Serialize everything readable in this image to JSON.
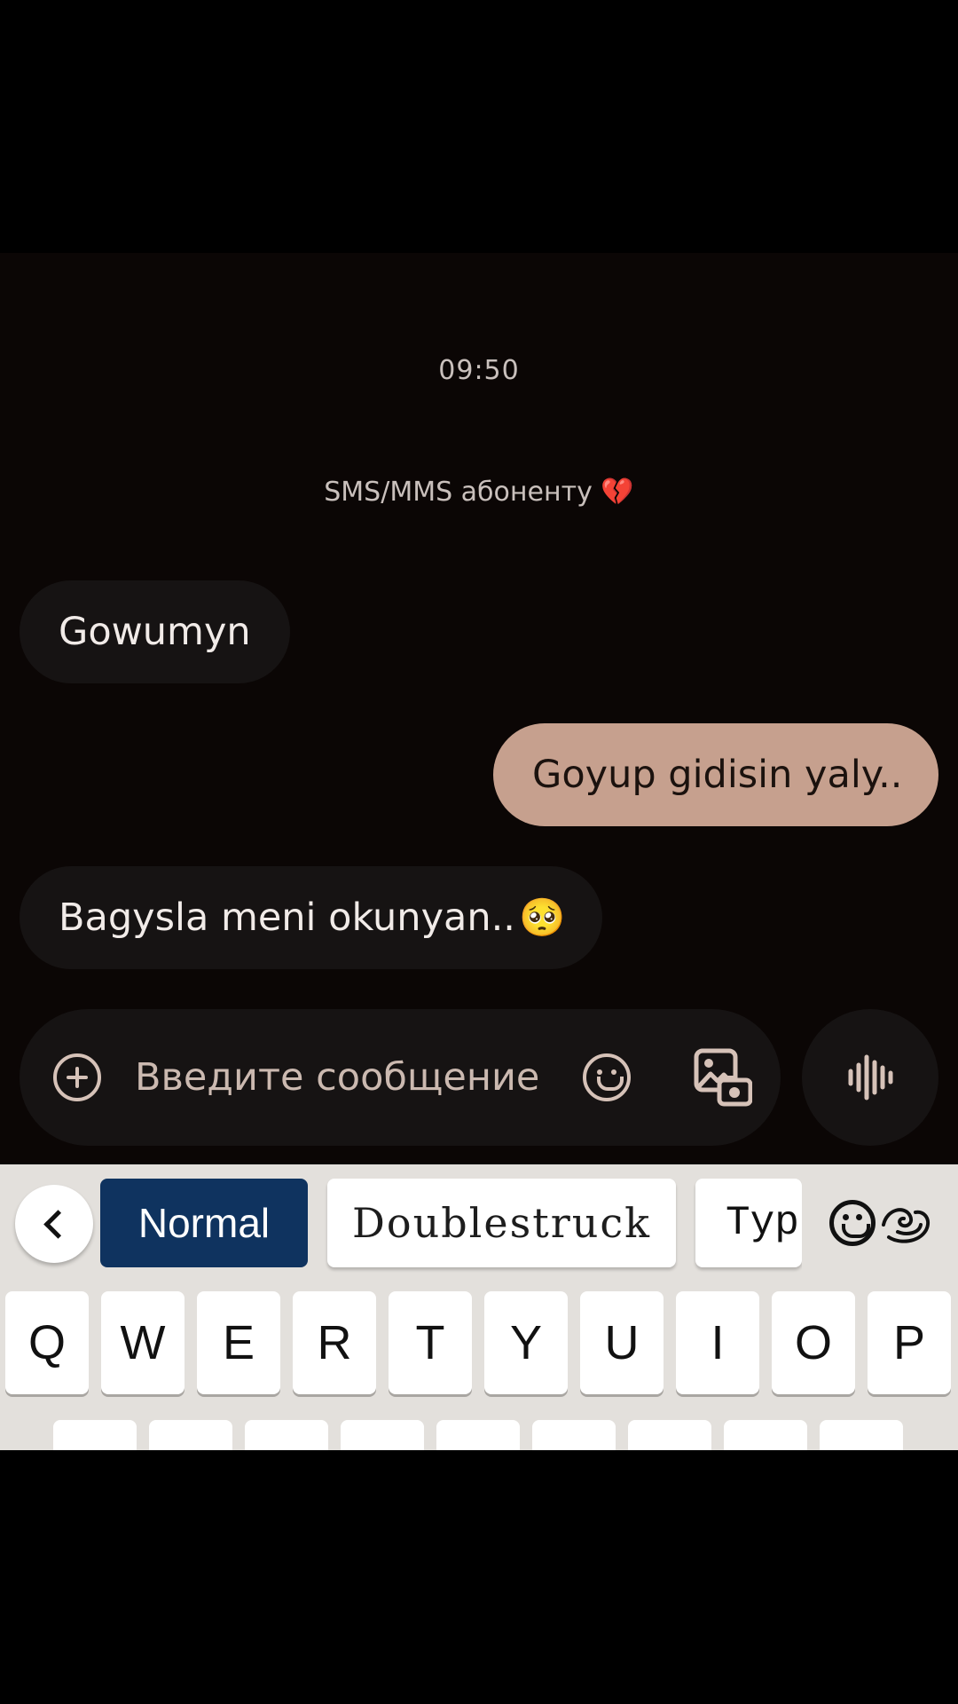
{
  "chat": {
    "timestamp": "09:50",
    "sms_note": "SMS/MMS абоненту",
    "sms_note_emoji": "💔",
    "messages": [
      {
        "direction": "incoming",
        "text": "Gowumyn",
        "emoji": ""
      },
      {
        "direction": "outgoing",
        "text": "Goyup gidisin yaly..",
        "emoji": ""
      },
      {
        "direction": "incoming",
        "text": "Bagysla meni okunyan..",
        "emoji": "🥺"
      }
    ]
  },
  "compose": {
    "placeholder": "Введите сообщение",
    "icons": [
      "add-icon",
      "emoji-icon",
      "gallery-icon",
      "voice-icon"
    ]
  },
  "keyboard": {
    "font_chips": [
      "Normal",
      "Doublestruck",
      "Typ"
    ],
    "selected_font": "Normal",
    "row1": [
      "Q",
      "W",
      "E",
      "R",
      "T",
      "Y",
      "U",
      "I",
      "O",
      "P"
    ]
  },
  "colors": {
    "chat_bg": "#0b0605",
    "incoming_bubble": "#161313",
    "outgoing_bubble": "#c6a08e",
    "selected_chip": "#0f335f",
    "keyboard_bg": "#e3e0dc"
  }
}
